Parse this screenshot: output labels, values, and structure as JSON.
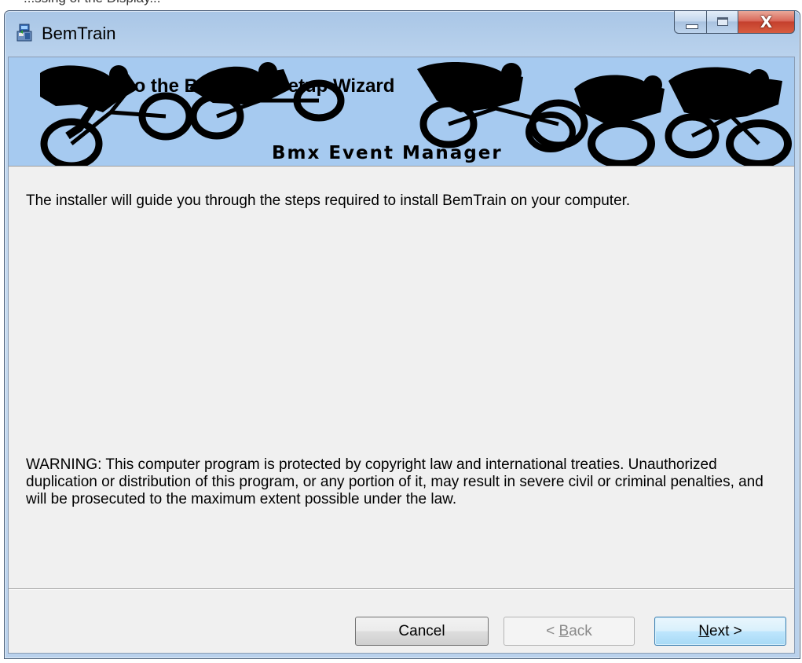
{
  "background_window": {
    "partial_text": "...ssing of the Display..."
  },
  "window": {
    "title": "BemTrain",
    "icon": "installer-icon",
    "controls": {
      "minimize_icon": "minimize-icon",
      "maximize_icon": "maximize-icon",
      "close_icon": "close-icon",
      "close_glyph": "X"
    }
  },
  "banner": {
    "welcome_text": "Welcome to the BemTrain Setup Wizard",
    "subtitle": "Bmx Event Manager",
    "art": "bmx-riders-illustration",
    "background_color": "#a6caf0"
  },
  "body": {
    "intro": "The installer will guide you through the steps required to install BemTrain on your computer.",
    "warning": "WARNING: This computer program is protected by copyright law and international treaties. Unauthorized duplication or distribution of this program, or any portion of it, may result in severe civil or criminal penalties, and will be prosecuted to the maximum extent possible under the law."
  },
  "buttons": {
    "cancel": "Cancel",
    "back_prefix": "< ",
    "back_accel": "B",
    "back_rest": "ack",
    "next_accel": "N",
    "next_rest": "ext >",
    "back_enabled": false
  }
}
